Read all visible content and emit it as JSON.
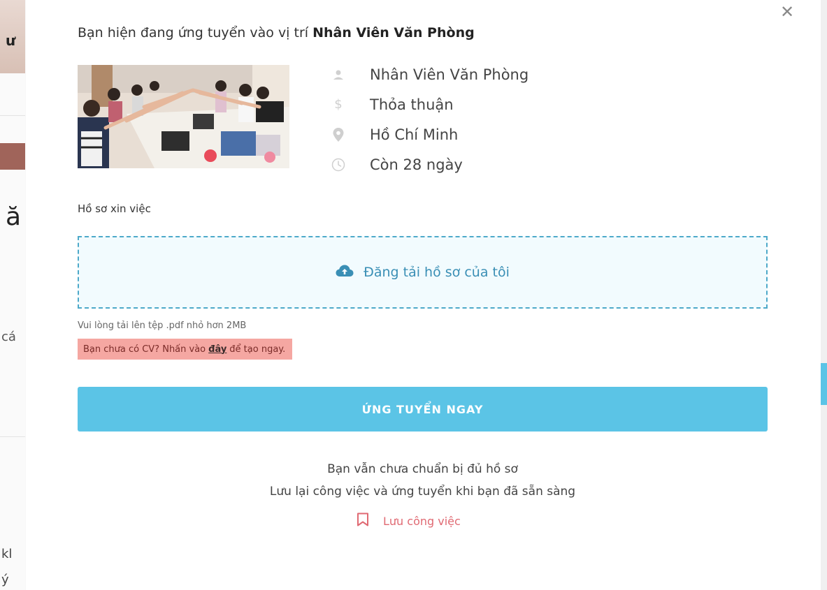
{
  "background": {
    "fragments": [
      "ư",
      "ă",
      "cá",
      "kl",
      "ý"
    ]
  },
  "modal": {
    "close_icon": "close-icon",
    "intro_prefix": "Bạn hiện đang ứng tuyển vào vị trí",
    "intro_position": "Nhân Viên Văn Phòng",
    "job_photo_alt": "office team photo",
    "details": [
      {
        "icon": "user-icon",
        "text": "Nhân Viên Văn Phòng"
      },
      {
        "icon": "dollar-icon",
        "text": "Thỏa thuận"
      },
      {
        "icon": "location-pin-icon",
        "text": "Hồ Chí Minh"
      },
      {
        "icon": "clock-icon",
        "text": "Còn 28 ngày"
      }
    ],
    "cv_section_label": "Hồ sơ xin việc",
    "upload": {
      "icon": "cloud-upload-icon",
      "label": "Đăng tải hồ sơ của tôi"
    },
    "upload_hint": "Vui lòng tải lên tệp .pdf nhỏ hơn 2MB",
    "no_cv": {
      "prefix": "Bạn chưa có CV? Nhấn vào",
      "link": "đây",
      "suffix": "để tạo ngay."
    },
    "apply_button": "ỨNG TUYỂN NGAY",
    "not_ready_line1": "Bạn vẫn chưa chuẩn bị đủ hồ sơ",
    "not_ready_line2": "Lưu lại công việc và ứng tuyển khi bạn đã sẵn sàng",
    "save_job": {
      "icon": "bookmark-icon",
      "label": "Lưu công việc"
    }
  },
  "colors": {
    "accent": "#5bc4e6",
    "upload_border": "#4da9c9",
    "upload_text": "#3a8fb5",
    "warning_bg": "#f5a7a2",
    "save_text": "#e06a73"
  }
}
